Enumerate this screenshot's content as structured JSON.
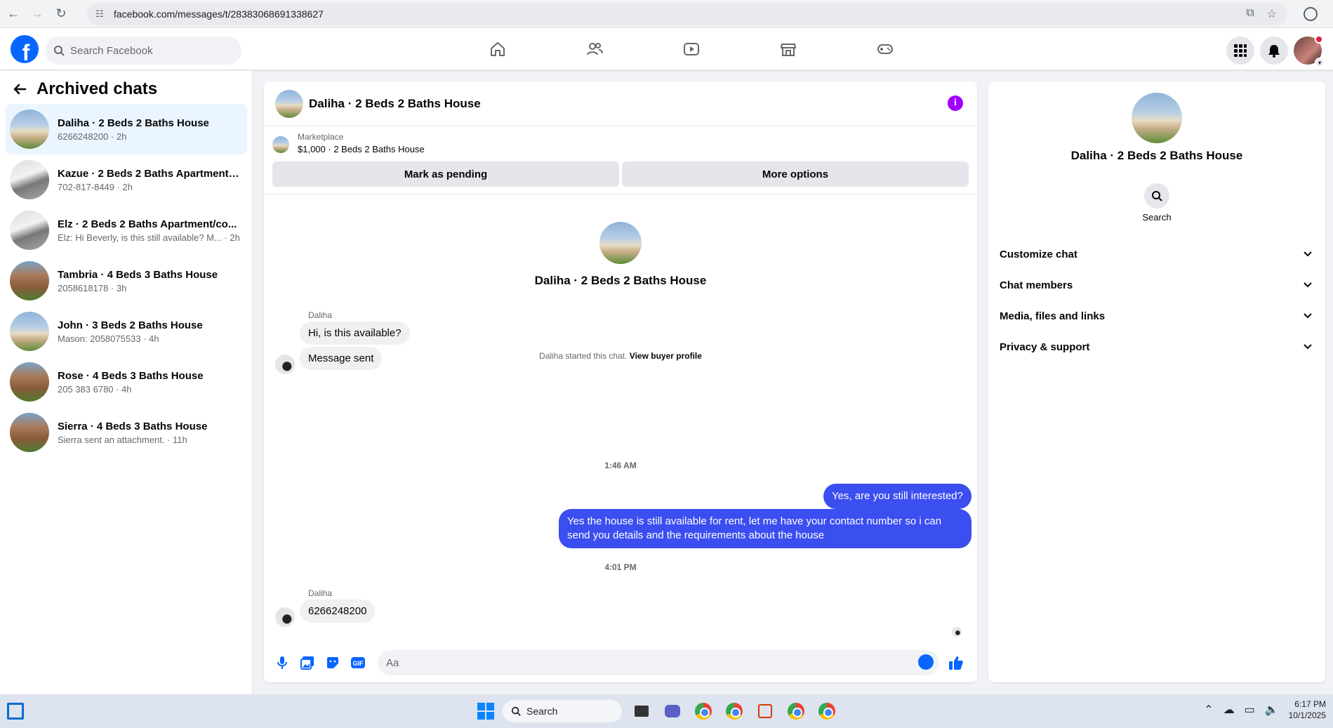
{
  "browser": {
    "url": "facebook.com/messages/t/28383068691338627"
  },
  "header": {
    "search_placeholder": "Search Facebook"
  },
  "sidebar": {
    "title": "Archived chats",
    "chats": [
      {
        "name": "Daliha · 2 Beds 2 Baths House",
        "sub": "6266248200 · 2h",
        "thumb": "house"
      },
      {
        "name": "Kazue · 2 Beds 2 Baths Apartment/...",
        "sub": "702-817-8449 · 2h",
        "thumb": "interior"
      },
      {
        "name": "Elz · 2 Beds 2 Baths Apartment/co...",
        "sub": "Elz: Hi Beverly, is this still available? M... · 2h",
        "thumb": "interior"
      },
      {
        "name": "Tambria · 4 Beds 3 Baths House",
        "sub": "2058618178 · 3h",
        "thumb": "brick"
      },
      {
        "name": "John · 3 Beds 2 Baths House",
        "sub": "Mason: 2058075533 · 4h",
        "thumb": "house"
      },
      {
        "name": "Rose · 4 Beds 3 Baths House",
        "sub": "205 383 6780 · 4h",
        "thumb": "brick"
      },
      {
        "name": "Sierra · 4 Beds 3 Baths House",
        "sub": "Sierra sent an attachment. · 11h",
        "thumb": "brick"
      }
    ]
  },
  "conversation": {
    "title": "Daliha · 2 Beds 2 Baths House",
    "marketplace_label": "Marketplace",
    "marketplace_item": "$1,000 · 2 Beds 2 Baths House",
    "mark_pending": "Mark as pending",
    "more_options": "More options",
    "intro_name": "Daliha · 2 Beds 2 Baths House",
    "started_text": "Daliha started this chat.",
    "view_profile": "View buyer profile",
    "sender": "Daliha",
    "msg1": "Hi, is this available?",
    "msg2": "Message sent",
    "time1": "1:46 AM",
    "out1": "Yes, are you still interested?",
    "out2": "Yes the house is still available for rent, let me have your contact number so i can send you details and the requirements about the house",
    "time2": "4:01 PM",
    "msg3": "6266248200",
    "composer_placeholder": "Aa"
  },
  "details": {
    "name": "Daliha · 2 Beds 2 Baths House",
    "search_label": "Search",
    "menu": [
      "Customize chat",
      "Chat members",
      "Media, files and links",
      "Privacy & support"
    ]
  },
  "taskbar": {
    "search": "Search",
    "time": "6:17 PM",
    "date": "10/1/2025"
  }
}
